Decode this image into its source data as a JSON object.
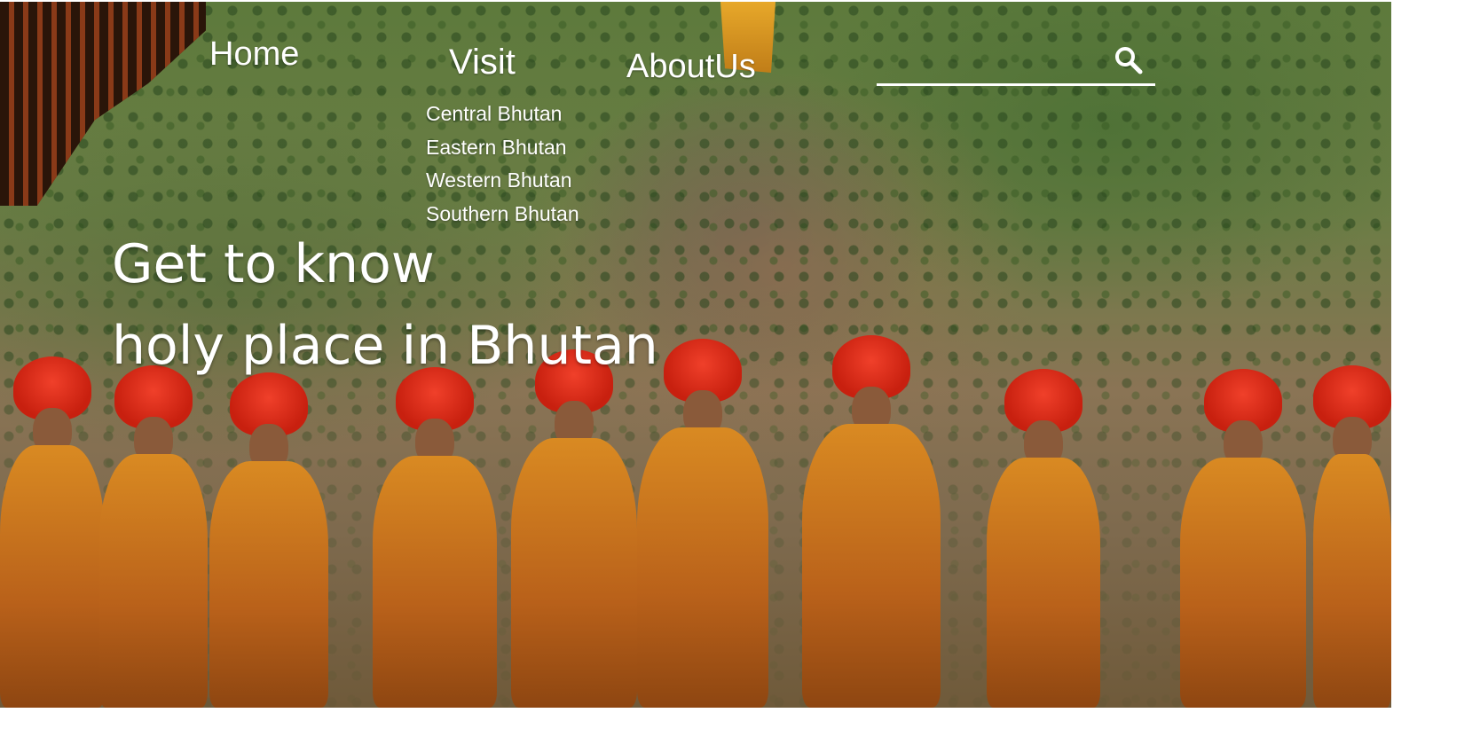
{
  "nav": {
    "home_label": "Home",
    "visit_label": "Visit",
    "about_label": "AboutUs"
  },
  "search": {
    "value": "",
    "placeholder": "",
    "icon": "search-icon"
  },
  "visit_menu": {
    "items": [
      {
        "label": "Central Bhutan"
      },
      {
        "label": "Eastern Bhutan"
      },
      {
        "label": "Western Bhutan"
      },
      {
        "label": "Southern Bhutan"
      }
    ]
  },
  "hero": {
    "title_line1": "Get to know",
    "title_line2": "holy place in Bhutan"
  },
  "colors": {
    "text": "#ffffff",
    "robe": "#d98a22",
    "hat": "#e0301c"
  }
}
